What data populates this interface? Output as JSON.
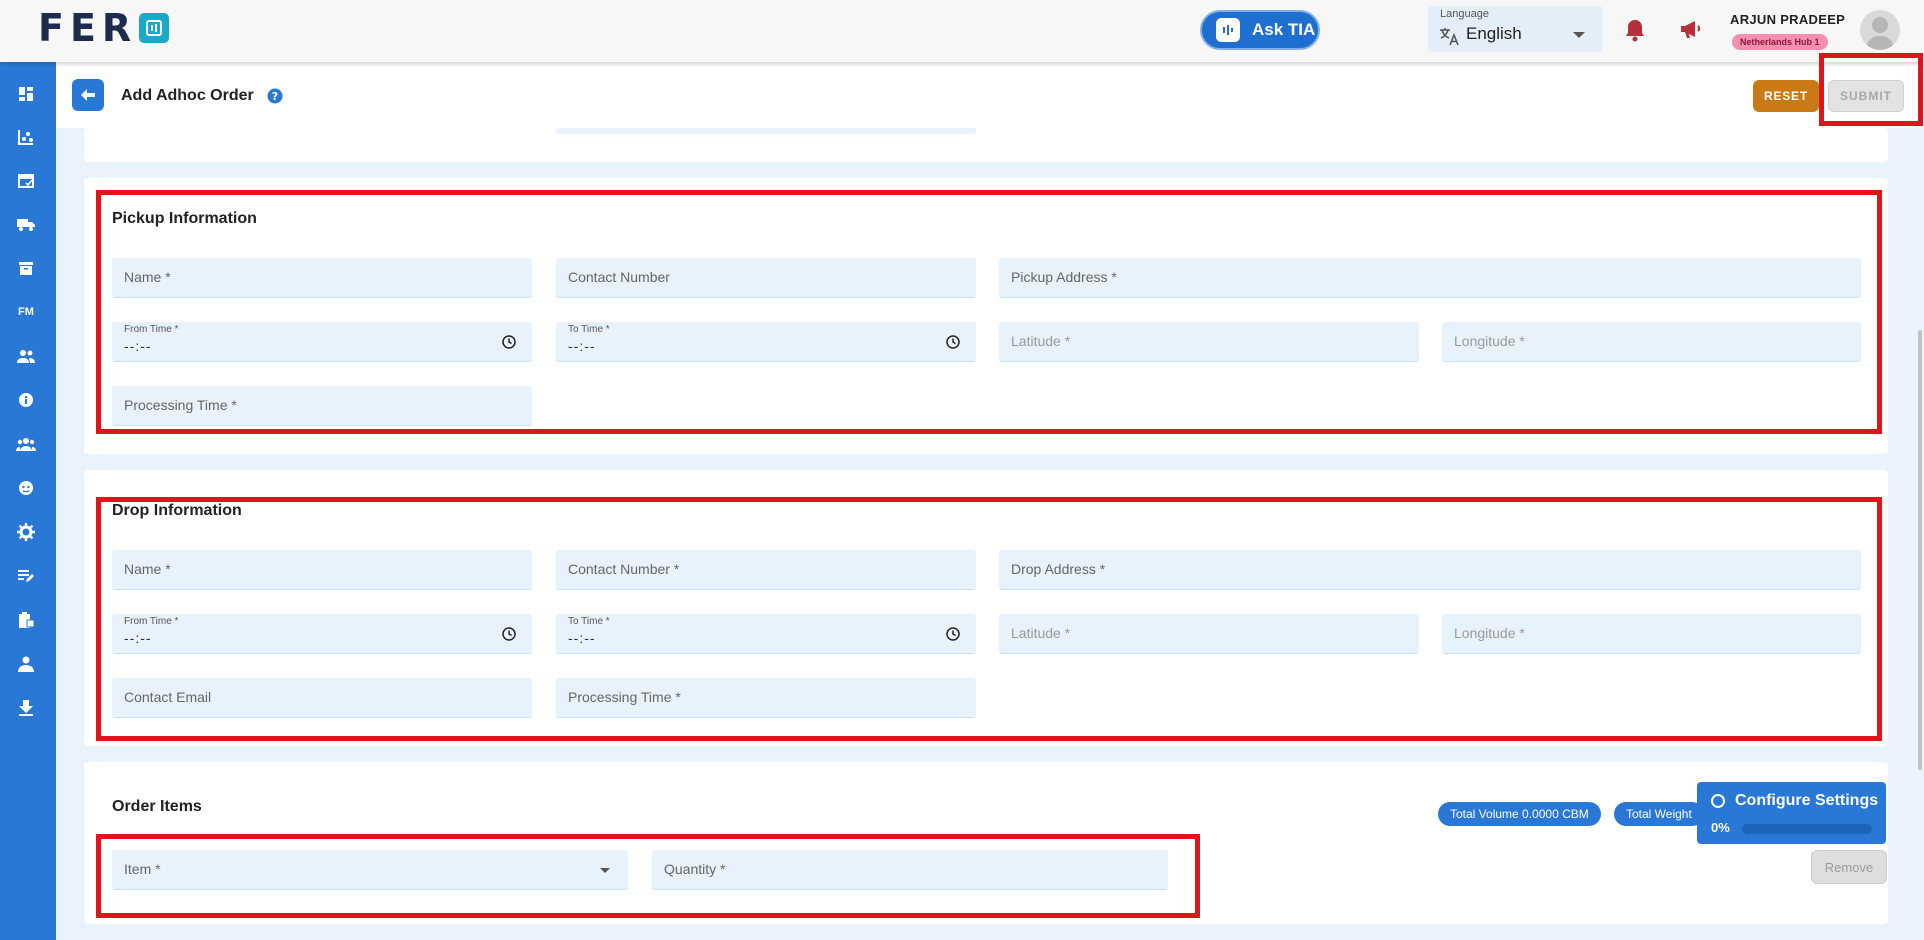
{
  "header": {
    "logo_text": "FER",
    "ask_tia_label": "Ask TIA",
    "language": {
      "caption": "Language",
      "value": "English"
    },
    "user": {
      "name": "ARJUN PRADEEP",
      "hub": "Netherlands Hub 1"
    }
  },
  "subheader": {
    "title": "Add Adhoc Order",
    "reset_label": "RESET",
    "submit_label": "SUBMIT"
  },
  "sidebar": {
    "items": [
      {
        "icon": "dashboard-icon"
      },
      {
        "icon": "analytics-icon"
      },
      {
        "icon": "calendar-icon"
      },
      {
        "icon": "truck-icon"
      },
      {
        "icon": "archive-icon"
      },
      {
        "icon": "fm-icon",
        "label": "FM"
      },
      {
        "icon": "users-icon"
      },
      {
        "icon": "info-icon"
      },
      {
        "icon": "groups-icon"
      },
      {
        "icon": "face-icon"
      },
      {
        "icon": "settings-icon"
      },
      {
        "icon": "edit-note-icon"
      },
      {
        "icon": "clipboard-icon"
      },
      {
        "icon": "person-badge-icon"
      },
      {
        "icon": "download-icon"
      }
    ]
  },
  "pickup": {
    "title": "Pickup Information",
    "name": "Name *",
    "contact_number": "Contact Number",
    "pickup_address": "Pickup Address *",
    "from_time_caption": "From Time *",
    "from_time_value": "--:--",
    "to_time_caption": "To Time *",
    "to_time_value": "--:--",
    "latitude": "Latitude *",
    "longitude": "Longitude *",
    "processing_time": "Processing Time *"
  },
  "drop": {
    "title": "Drop Information",
    "name": "Name *",
    "contact_number": "Contact Number *",
    "drop_address": "Drop Address *",
    "from_time_caption": "From Time *",
    "from_time_value": "--:--",
    "to_time_caption": "To Time *",
    "to_time_value": "--:--",
    "latitude": "Latitude *",
    "longitude": "Longitude *",
    "contact_email": "Contact Email",
    "processing_time": "Processing Time *"
  },
  "order_items": {
    "title": "Order Items",
    "total_volume": "Total Volume  0.0000 CBM",
    "total_weight": "Total Weight",
    "item": "Item *",
    "quantity": "Quantity *",
    "remove_label": "Remove"
  },
  "configure": {
    "label": "Configure Settings",
    "progress_text": "0%",
    "progress_percent": 0
  },
  "colors": {
    "brand_blue": "#2a78d6",
    "reset_orange": "#c97a17",
    "highlight_red": "#e0151b",
    "field_bg": "#e7f2fd"
  }
}
